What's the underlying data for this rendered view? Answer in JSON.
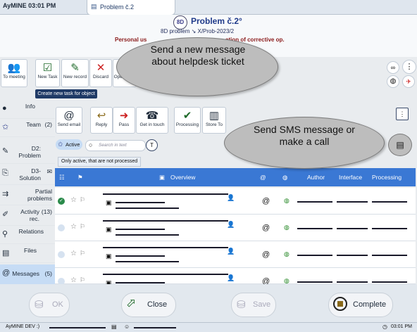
{
  "topbar": {
    "app_label": "AyMINE 03:01 PM",
    "tab_label": "Problem č.2"
  },
  "header": {
    "badge": "8D",
    "title": "Problem č.2°",
    "subtitle": "8D problem  ↘  X/Prob-2023/2",
    "subtitle2_left": "Personal us",
    "subtitle2_right": "ation of corrective op."
  },
  "toolbar": {
    "to_meeting": "To meeting",
    "new_task": "New Task",
    "new_record": "New record",
    "discard": "Discard",
    "open_area": "Open area",
    "tooltip": "Create new task for object"
  },
  "callouts": {
    "helpdesk": "Send a new message about helpdesk ticket",
    "sms": "Send SMS message or make a call"
  },
  "sidebar": {
    "items": [
      {
        "label": "Info",
        "count": ""
      },
      {
        "label": "Team",
        "count": "(2)"
      },
      {
        "label": "D2: Problem",
        "count": ""
      },
      {
        "label": "D3-Solution",
        "count": ""
      },
      {
        "label": "Partial problems",
        "count": ""
      },
      {
        "label": "Activity rec.",
        "count": "(13)"
      },
      {
        "label": "Relations",
        "count": ""
      },
      {
        "label": "Files",
        "count": ""
      },
      {
        "label": "Messages",
        "count": "(5)"
      }
    ]
  },
  "msg_toolbar": {
    "send_email": "Send email",
    "reply": "Reply",
    "pass": "Pass",
    "get_in_touch": "Get in touch",
    "processing": "Processing",
    "store_to": "Store To"
  },
  "filter": {
    "active_label": "Active",
    "search_placeholder": "Search in text",
    "hint": "Only active, that are not processed"
  },
  "table": {
    "columns": {
      "overview": "Overview",
      "author": "Author",
      "interface": "Interface",
      "processing": "Processing"
    },
    "rows": 4
  },
  "bottom": {
    "ok": "OK",
    "close": "Close",
    "save": "Save",
    "complete": "Complete"
  },
  "status": {
    "left": "AyMINE DEV :)",
    "right": "03:01 PM"
  },
  "colors": {
    "accent": "#3a78d4",
    "header_blue": "#1f3a8a",
    "complete_box": "#8a6a1a"
  }
}
